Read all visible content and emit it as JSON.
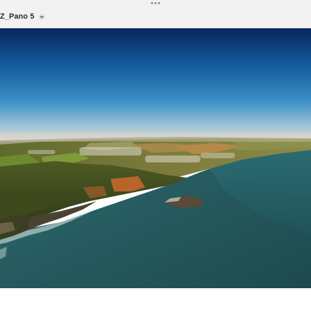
{
  "window": {
    "title": "Z_Pano 5"
  },
  "icons": {
    "more": "more-dots-icon",
    "title_menu": "chevron-down-icon"
  },
  "photo": {
    "subject": "coastal-aerial-panorama"
  },
  "colors": {
    "titlebar_bg": "#f2f2f3",
    "sky_top": "#0a2a6a",
    "sky_horizon": "#dcd9cf",
    "sea": "#245f6a"
  }
}
